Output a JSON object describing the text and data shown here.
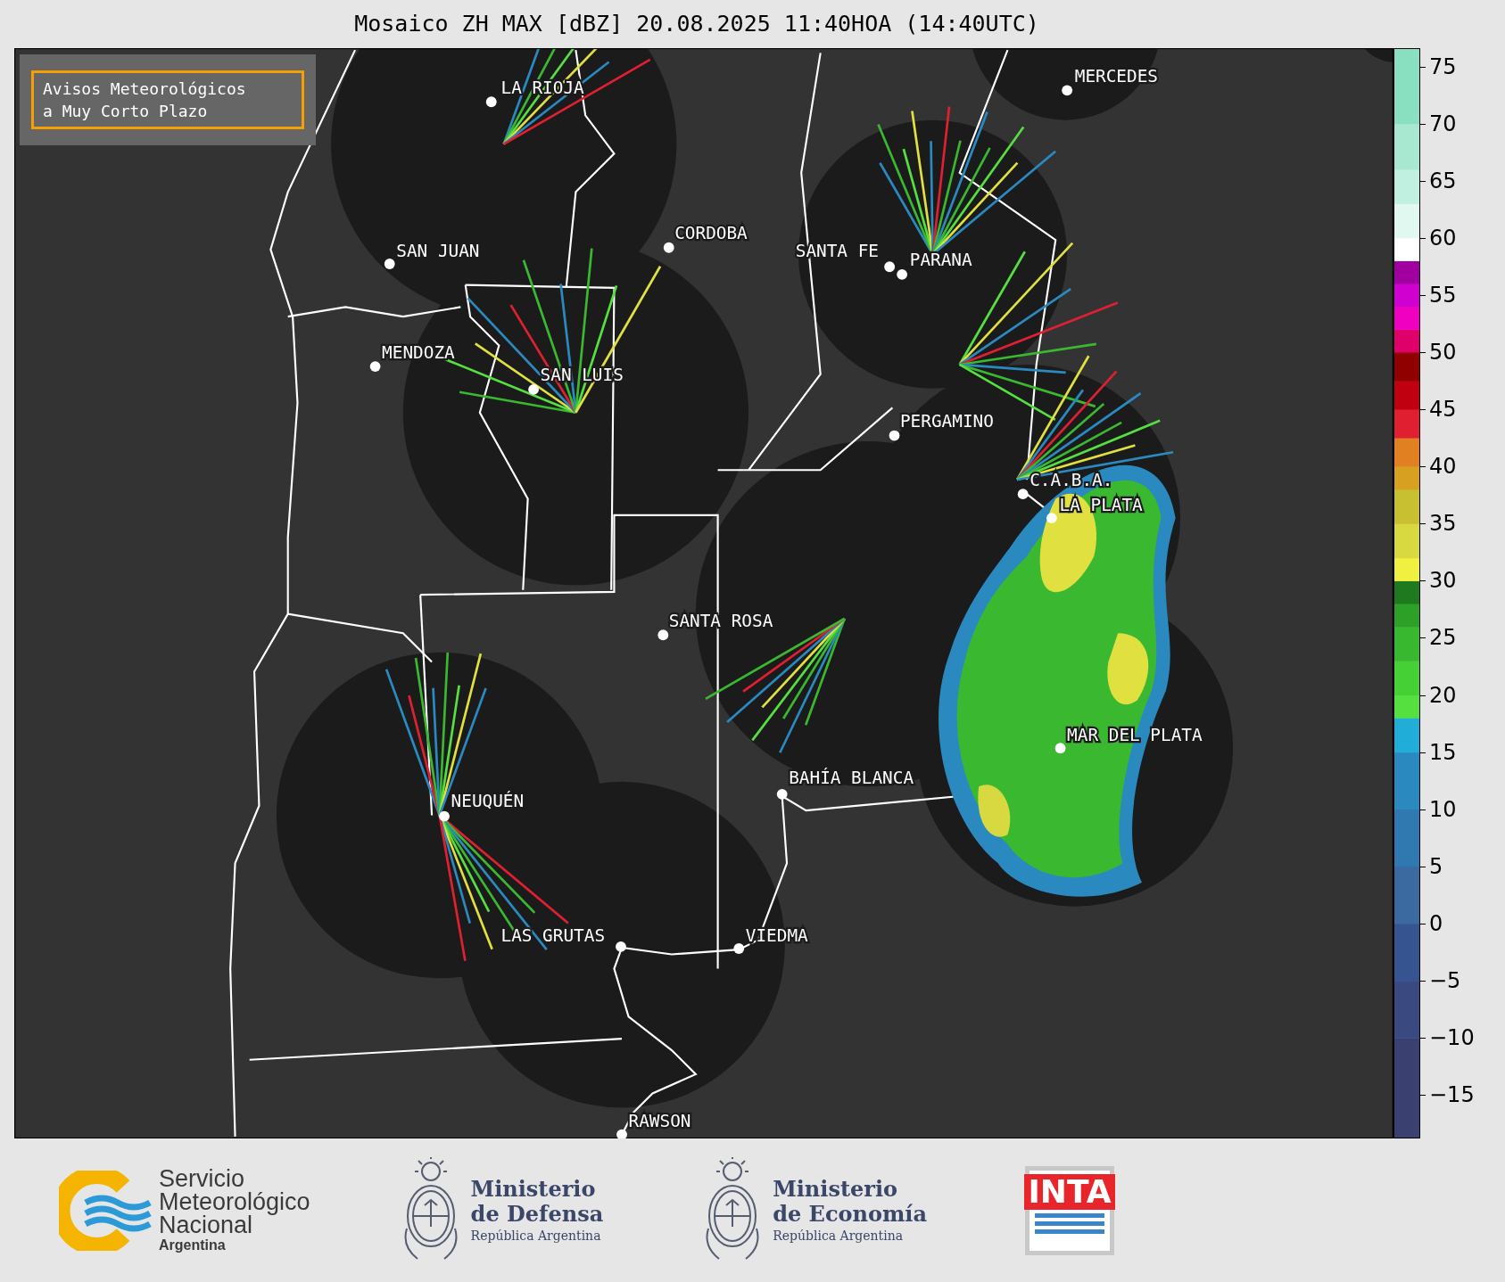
{
  "title": "Mosaico ZH MAX [dBZ] 20.08.2025 11:40HOA (14:40UTC)",
  "notice": "Avisos Meteorológicos\na Muy Corto Plazo",
  "cities": [
    {
      "name": "LA RIOJA"
    },
    {
      "name": "MERCEDES"
    },
    {
      "name": "CORDOBA"
    },
    {
      "name": "SAN JUAN"
    },
    {
      "name": "SANTA FE"
    },
    {
      "name": "PARANA"
    },
    {
      "name": "MENDOZA"
    },
    {
      "name": "SAN LUIS"
    },
    {
      "name": "PERGAMINO"
    },
    {
      "name": "C.A.B.A."
    },
    {
      "name": "LA PLATA"
    },
    {
      "name": "SANTA ROSA"
    },
    {
      "name": "MAR DEL PLATA"
    },
    {
      "name": "BAHÍA BLANCA"
    },
    {
      "name": "NEUQUÉN"
    },
    {
      "name": "LAS GRUTAS"
    },
    {
      "name": "VIEDMA"
    },
    {
      "name": "RAWSON"
    }
  ],
  "colorbar": {
    "ticks": [
      "75",
      "70",
      "65",
      "60",
      "55",
      "50",
      "45",
      "40",
      "35",
      "30",
      "25",
      "20",
      "15",
      "10",
      "5",
      "0",
      "−5",
      "−10",
      "−15"
    ]
  },
  "logos": [
    {
      "kind": "smn",
      "lines": [
        "Servicio",
        "Meteorológico",
        "Nacional"
      ],
      "subtitle": "Argentina"
    },
    {
      "kind": "ministry",
      "lines": [
        "Ministerio",
        "de Defensa"
      ],
      "subtitle": "República Argentina"
    },
    {
      "kind": "ministry",
      "lines": [
        "Ministerio",
        "de Economía"
      ],
      "subtitle": "República Argentina"
    },
    {
      "kind": "inta",
      "text": "INTA"
    }
  ]
}
